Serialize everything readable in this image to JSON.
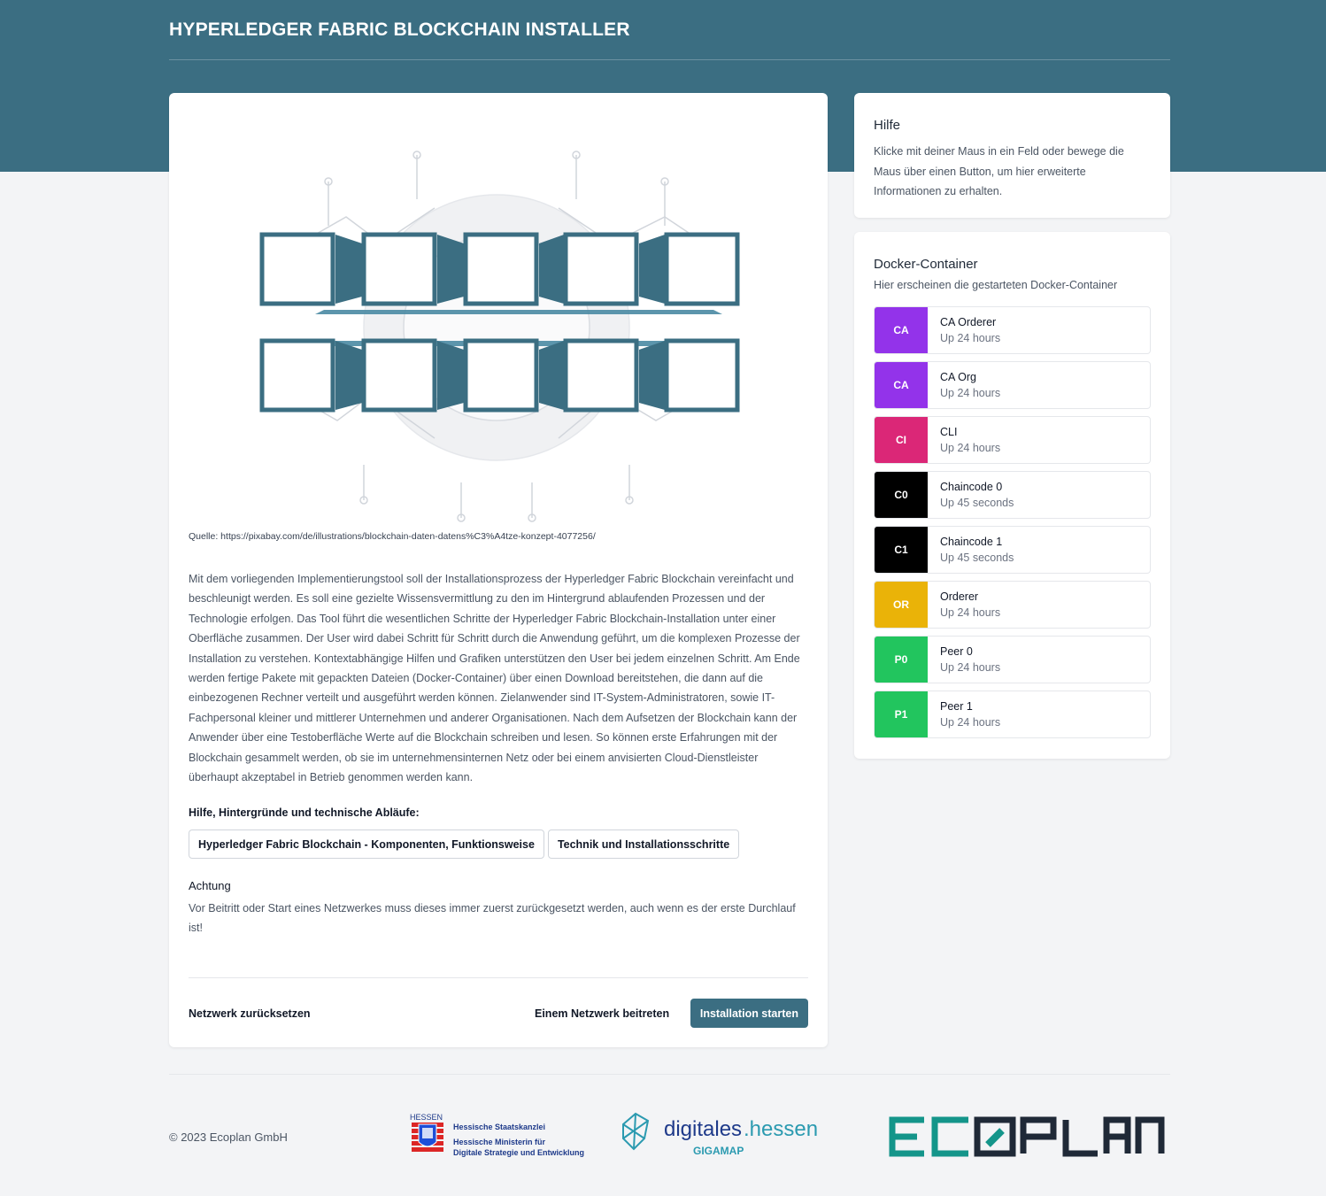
{
  "header": {
    "title": "HYPERLEDGER FABRIC BLOCKCHAIN INSTALLER"
  },
  "main": {
    "source": "Quelle: https://pixabay.com/de/illustrations/blockchain-daten-datens%C3%A4tze-konzept-4077256/",
    "intro": "Mit dem vorliegenden Implementierungstool soll der Installationsprozess der Hyperledger Fabric Blockchain vereinfacht und beschleunigt werden. Es soll eine gezielte Wissensvermittlung zu den im Hintergrund ablaufenden Prozessen und der Technologie erfolgen. Das Tool führt die wesentlichen Schritte der Hyperledger Fabric Blockchain-Installation unter einer Oberfläche zusammen. Der User wird dabei Schritt für Schritt durch die Anwendung geführt, um die komplexen Prozesse der Installation zu verstehen. Kontextabhängige Hilfen und Grafiken unterstützen den User bei jedem einzelnen Schritt. Am Ende werden fertige Pakete mit gepackten Dateien (Docker-Container) über einen Download bereitstehen, die dann auf die einbezogenen Rechner verteilt und ausgeführt werden können. Zielanwender sind IT-System-Administratoren, sowie IT-Fachpersonal kleiner und mittlerer Unternehmen und anderer Organisationen. Nach dem Aufsetzen der Blockchain kann der Anwender über eine Testoberfläche Werte auf die Blockchain schreiben und lesen. So können erste Erfahrungen mit der Blockchain gesammelt werden, ob sie im unternehmensinternen Netz oder bei einem anvisierten Cloud-Dienstleister überhaupt akzeptabel in Betrieb genommen werden kann.",
    "help_label": "Hilfe, Hintergründe und technische Abläufe:",
    "link_buttons": [
      "Hyperledger Fabric Blockchain - Komponenten, Funktionsweise",
      "Technik und Installationsschritte"
    ],
    "warning_title": "Achtung",
    "warning_text": "Vor Beitritt oder Start eines Netzwerkes muss dieses immer zuerst zurückgesetzt werden, auch wenn es der erste Durchlauf ist!",
    "actions": {
      "reset": "Netzwerk zurücksetzen",
      "join": "Einem Netzwerk beitreten",
      "start": "Installation starten"
    }
  },
  "help": {
    "title": "Hilfe",
    "text": "Klicke mit deiner Maus in ein Feld oder bewege die Maus über einen Button, um hier erweiterte Informationen zu erhalten."
  },
  "docker": {
    "title": "Docker-Container",
    "subtitle": "Hier erscheinen die gestarteten Docker-Container",
    "containers": [
      {
        "badge": "CA",
        "name": "CA Orderer",
        "status": "Up 24 hours",
        "color": "#9333ea"
      },
      {
        "badge": "CA",
        "name": "CA Org",
        "status": "Up 24 hours",
        "color": "#9333ea"
      },
      {
        "badge": "CI",
        "name": "CLI",
        "status": "Up 24 hours",
        "color": "#db2777"
      },
      {
        "badge": "C0",
        "name": "Chaincode 0",
        "status": "Up 45 seconds",
        "color": "#000000"
      },
      {
        "badge": "C1",
        "name": "Chaincode 1",
        "status": "Up 45 seconds",
        "color": "#000000"
      },
      {
        "badge": "OR",
        "name": "Orderer",
        "status": "Up 24 hours",
        "color": "#eab308"
      },
      {
        "badge": "P0",
        "name": "Peer 0",
        "status": "Up 24 hours",
        "color": "#22c55e"
      },
      {
        "badge": "P1",
        "name": "Peer 1",
        "status": "Up 24 hours",
        "color": "#22c55e"
      }
    ]
  },
  "footer": {
    "copyright": "© 2023 Ecoplan GmbH",
    "hessen_label": "HESSEN",
    "hessen_line1": "Hessische Staatskanzlei",
    "hessen_line2": "Hessische Ministerin für",
    "hessen_line3": "Digitale Strategie und Entwicklung",
    "dh_main_a": "digitales",
    "dh_main_b": ".hessen",
    "dh_sub": "GIGAMAP",
    "eco_logo": "ECOPLAN"
  },
  "colors": {
    "brand": "#3b6e82",
    "background": "#f3f4f6"
  }
}
